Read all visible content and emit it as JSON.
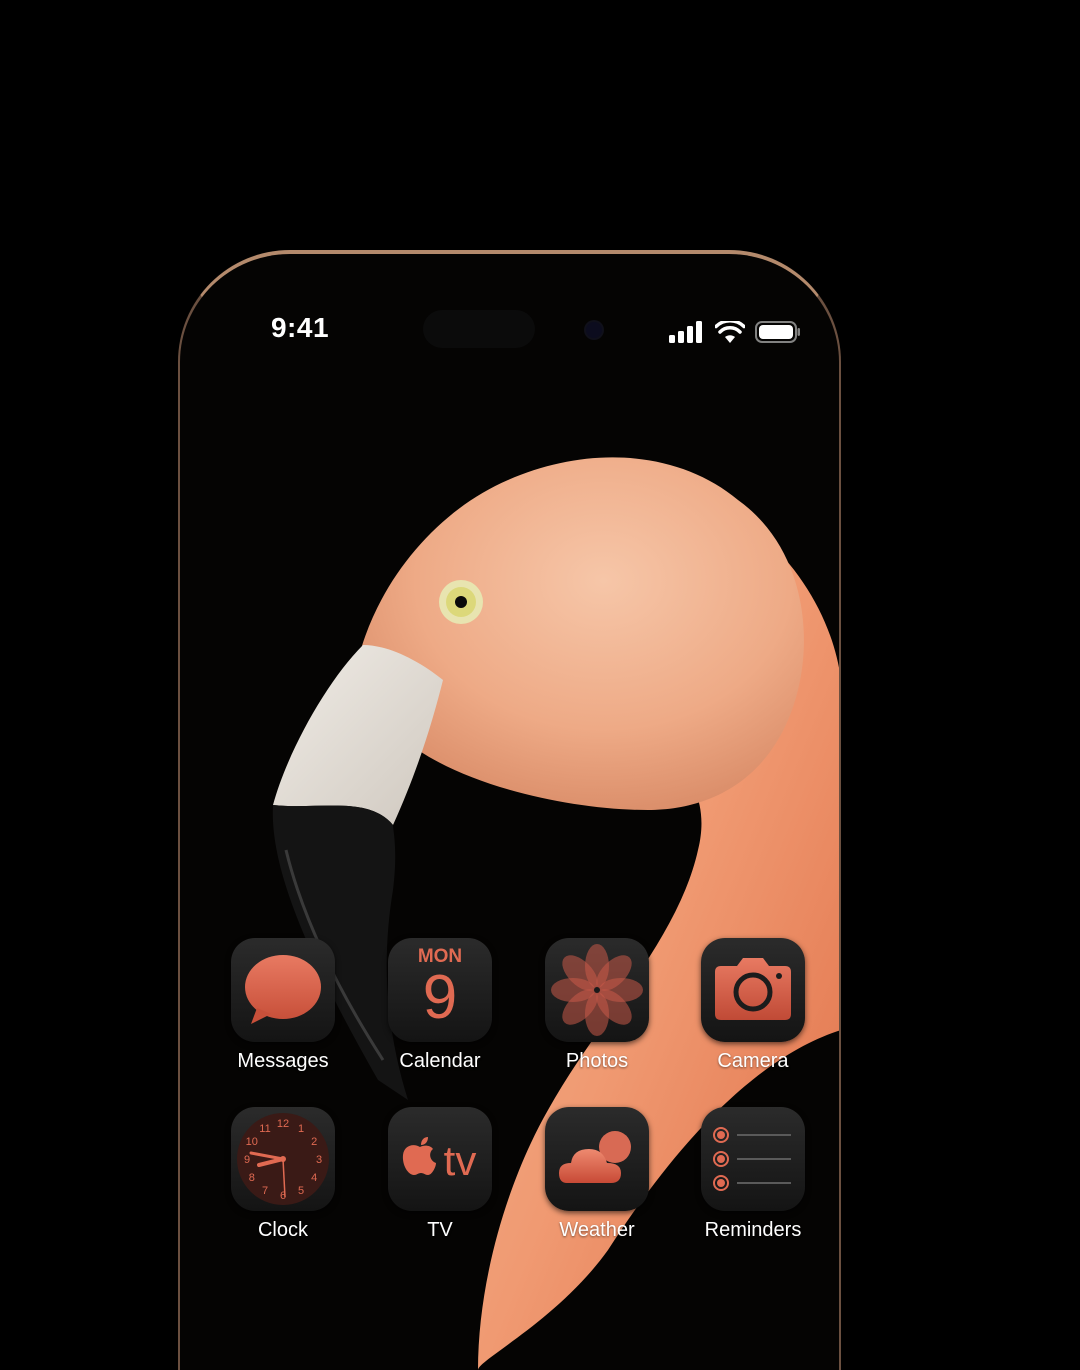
{
  "status_bar": {
    "time": "9:41"
  },
  "apps": [
    {
      "label": "Messages"
    },
    {
      "label": "Calendar",
      "day": "MON",
      "date": "9"
    },
    {
      "label": "Photos"
    },
    {
      "label": "Camera"
    },
    {
      "label": "Clock",
      "dial": [
        "12",
        "1",
        "2",
        "3",
        "4",
        "5",
        "6",
        "7",
        "8",
        "9",
        "10",
        "11"
      ]
    },
    {
      "label": "TV",
      "glyph": "tv"
    },
    {
      "label": "Weather"
    },
    {
      "label": "Reminders"
    }
  ],
  "colors": {
    "accent": "#e06a52",
    "icon_bg": "#1c1c1c",
    "frame": "#b48a6c"
  }
}
